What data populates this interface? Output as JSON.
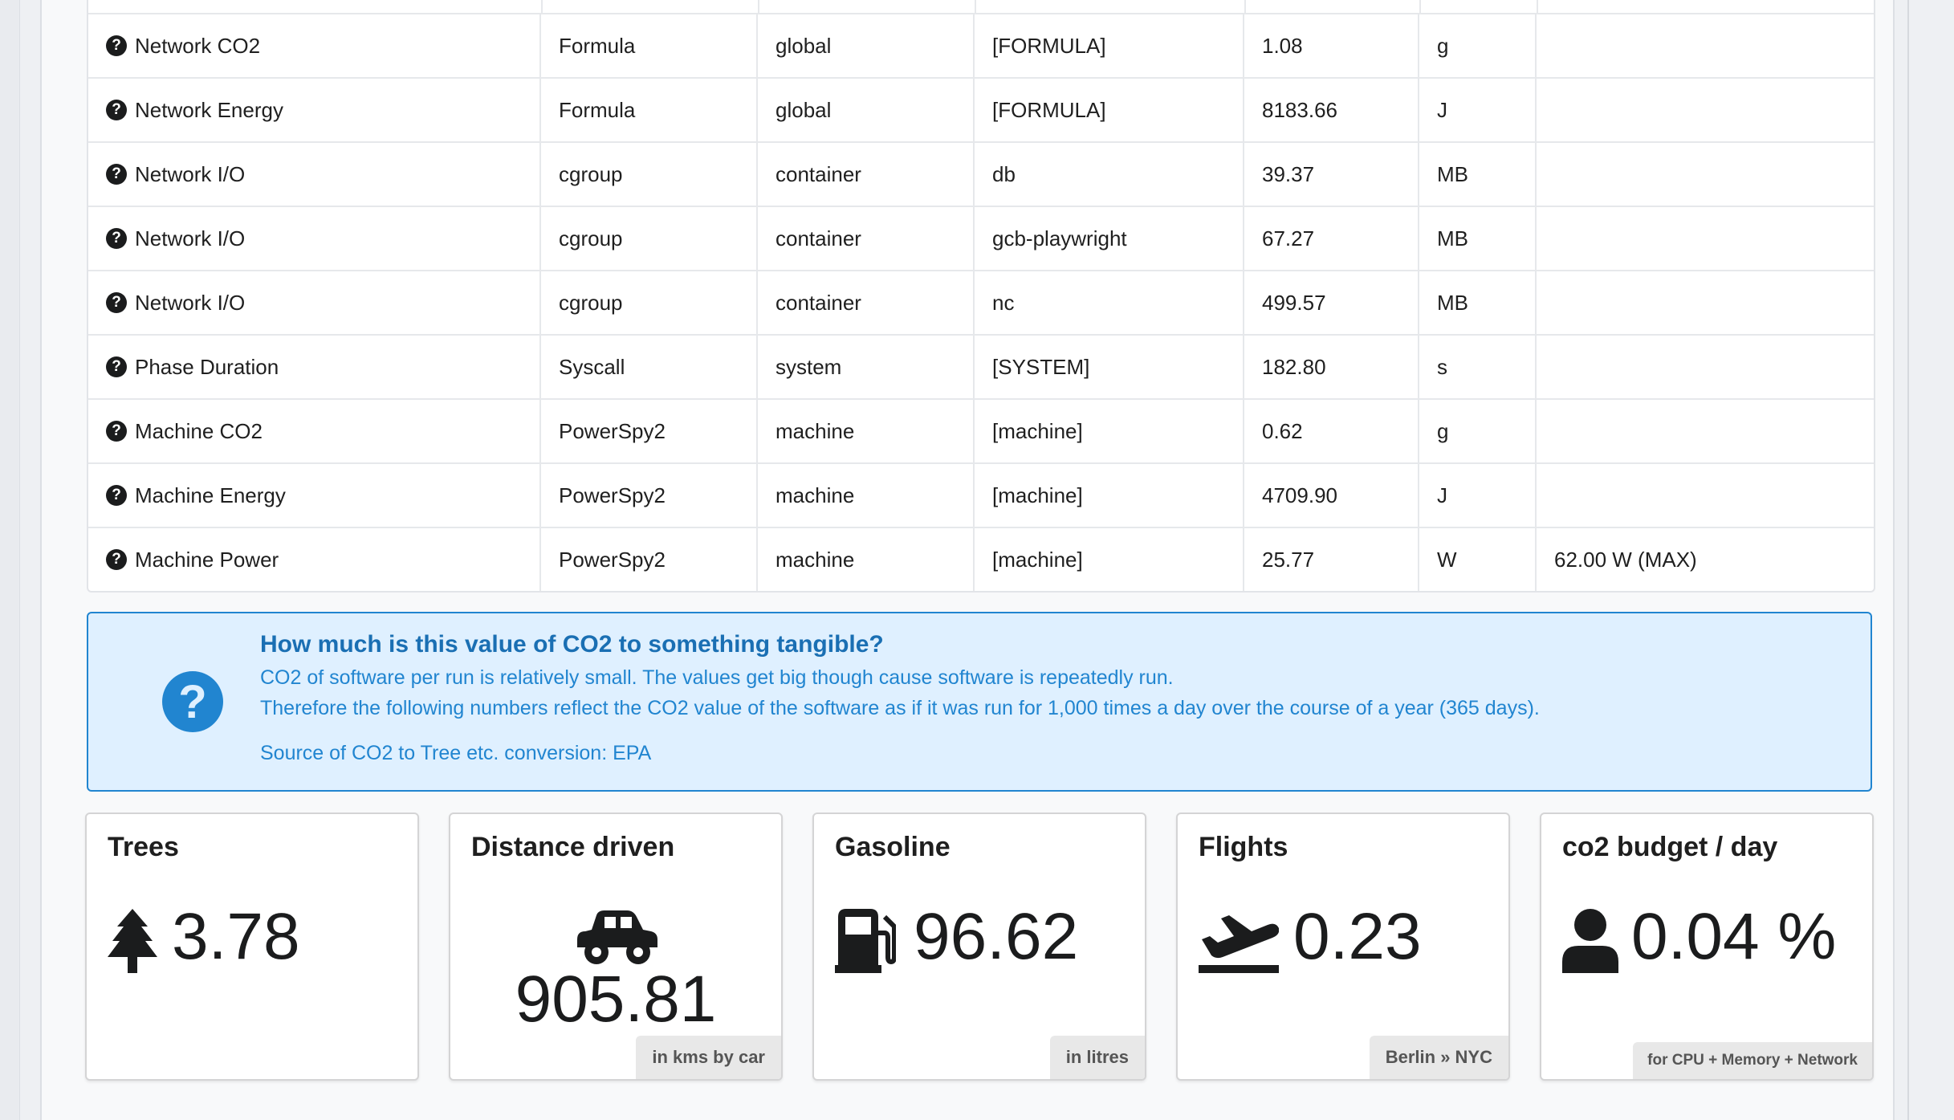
{
  "table": {
    "rows": [
      {
        "metric": "Network CO2",
        "source": "Formula",
        "scope": "global",
        "detail": "[FORMULA]",
        "value": "1.08",
        "unit": "g",
        "extra": ""
      },
      {
        "metric": "Network Energy",
        "source": "Formula",
        "scope": "global",
        "detail": "[FORMULA]",
        "value": "8183.66",
        "unit": "J",
        "extra": ""
      },
      {
        "metric": "Network I/O",
        "source": "cgroup",
        "scope": "container",
        "detail": "db",
        "value": "39.37",
        "unit": "MB",
        "extra": ""
      },
      {
        "metric": "Network I/O",
        "source": "cgroup",
        "scope": "container",
        "detail": "gcb-playwright",
        "value": "67.27",
        "unit": "MB",
        "extra": ""
      },
      {
        "metric": "Network I/O",
        "source": "cgroup",
        "scope": "container",
        "detail": "nc",
        "value": "499.57",
        "unit": "MB",
        "extra": ""
      },
      {
        "metric": "Phase Duration",
        "source": "Syscall",
        "scope": "system",
        "detail": "[SYSTEM]",
        "value": "182.80",
        "unit": "s",
        "extra": ""
      },
      {
        "metric": "Machine CO2",
        "source": "PowerSpy2",
        "scope": "machine",
        "detail": "[machine]",
        "value": "0.62",
        "unit": "g",
        "extra": ""
      },
      {
        "metric": "Machine Energy",
        "source": "PowerSpy2",
        "scope": "machine",
        "detail": "[machine]",
        "value": "4709.90",
        "unit": "J",
        "extra": ""
      },
      {
        "metric": "Machine Power",
        "source": "PowerSpy2",
        "scope": "machine",
        "detail": "[machine]",
        "value": "25.77",
        "unit": "W",
        "extra": "62.00 W (MAX)"
      }
    ]
  },
  "info": {
    "title": "How much is this value of CO2 to something tangible?",
    "line1": "CO2 of software per run is relatively small. The values get big though cause software is repeatedly run.",
    "line2": "Therefore the following numbers reflect the CO2 value of the software as if it was run for 1,000 times a day over the course of a year (365 days).",
    "source_prefix": "Source of CO2 to Tree etc. conversion: ",
    "source_link": "EPA"
  },
  "cards": {
    "trees": {
      "title": "Trees",
      "value": "3.78",
      "icon": "tree-icon"
    },
    "distance": {
      "title": "Distance driven",
      "value": "905.81",
      "label": "in kms by car",
      "icon": "car-icon"
    },
    "gasoline": {
      "title": "Gasoline",
      "value": "96.62",
      "label": "in litres",
      "icon": "gas-pump-icon"
    },
    "flights": {
      "title": "Flights",
      "value": "0.23",
      "label": "Berlin » NYC",
      "icon": "plane-departure-icon"
    },
    "budget": {
      "title": "co2 budget / day",
      "value": "0.04 %",
      "label": "for CPU + Memory + Network",
      "icon": "user-icon"
    }
  }
}
